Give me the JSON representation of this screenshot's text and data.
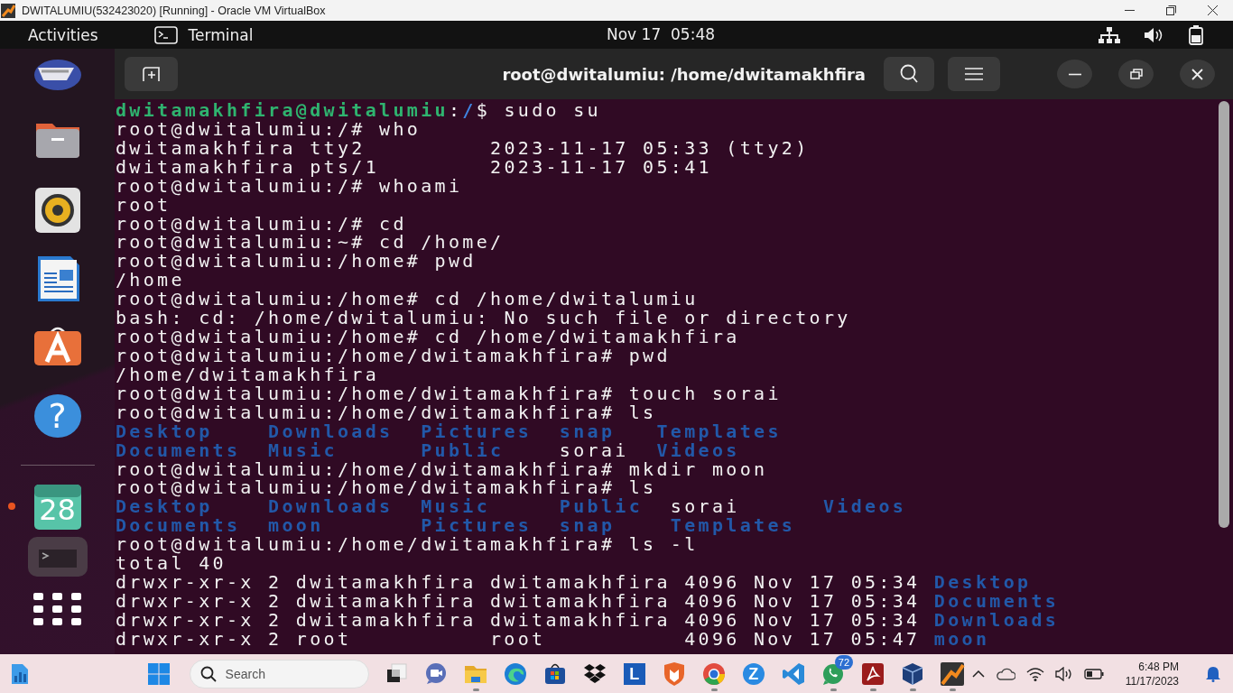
{
  "title_bar": {
    "title": "DWITALUMIU(532423020) [Running] - Oracle VM VirtualBox"
  },
  "top_bar": {
    "activities": "Activities",
    "app_name": "Terminal",
    "clock": "Nov 17  05:48"
  },
  "dock": {
    "pinned": [
      {
        "kind": "partial",
        "running": false
      },
      {
        "kind": "files",
        "running": false
      },
      {
        "kind": "speaker",
        "running": false
      },
      {
        "kind": "writer",
        "running": false
      },
      {
        "kind": "store",
        "running": false
      },
      {
        "kind": "help",
        "running": false,
        "glyph": "?"
      }
    ],
    "others": [
      {
        "kind": "calendar",
        "running": true,
        "glyph": "28"
      },
      {
        "kind": "terminal",
        "running": false
      }
    ]
  },
  "terminal": {
    "title": "root@dwitalumiu: /home/dwitamakhfira",
    "lines": [
      {
        "kind": "prompt",
        "segments": [
          {
            "text": "dwitamakhfira@dwitalumiu",
            "kind": "user"
          },
          {
            "text": ":",
            "kind": "plain"
          },
          {
            "text": "/",
            "kind": "path"
          },
          {
            "text": "$ sudo su",
            "kind": "plain"
          }
        ]
      },
      {
        "kind": "text",
        "text": "root@dwitalumiu:/# who"
      },
      {
        "kind": "text",
        "text": "dwitamakhfira tty2         2023-11-17 05:33 (tty2)"
      },
      {
        "kind": "text",
        "text": "dwitamakhfira pts/1        2023-11-17 05:41"
      },
      {
        "kind": "text",
        "text": "root@dwitalumiu:/# whoami"
      },
      {
        "kind": "text",
        "text": "root"
      },
      {
        "kind": "text",
        "text": "root@dwitalumiu:/# cd"
      },
      {
        "kind": "text",
        "text": "root@dwitalumiu:~# cd /home/"
      },
      {
        "kind": "text",
        "text": "root@dwitalumiu:/home# pwd"
      },
      {
        "kind": "text",
        "text": "/home"
      },
      {
        "kind": "text",
        "text": "root@dwitalumiu:/home# cd /home/dwitalumiu"
      },
      {
        "kind": "text",
        "text": "bash: cd: /home/dwitalumiu: No such file or directory"
      },
      {
        "kind": "text",
        "text": "root@dwitalumiu:/home# cd /home/dwitamakhfira"
      },
      {
        "kind": "text",
        "text": "root@dwitalumiu:/home/dwitamakhfira# pwd"
      },
      {
        "kind": "text",
        "text": "/home/dwitamakhfira"
      },
      {
        "kind": "text",
        "text": "root@dwitalumiu:/home/dwitamakhfira# touch sorai"
      },
      {
        "kind": "text",
        "text": "root@dwitalumiu:/home/dwitamakhfira# ls"
      },
      {
        "kind": "short_listing",
        "rows": [
          [
            {
              "text": "Desktop",
              "dir": true
            },
            {
              "text": "Downloads",
              "dir": true
            },
            {
              "text": "Pictures",
              "dir": true
            },
            {
              "text": "snap",
              "dir": true
            },
            {
              "text": "Templates",
              "dir": true
            }
          ],
          [
            {
              "text": "Documents",
              "dir": true
            },
            {
              "text": "Music",
              "dir": true
            },
            {
              "text": "Public",
              "dir": true
            },
            {
              "text": "sorai",
              "dir": false
            },
            {
              "text": "Videos",
              "dir": true
            }
          ]
        ]
      },
      {
        "kind": "text",
        "text": "root@dwitalumiu:/home/dwitamakhfira# mkdir moon"
      },
      {
        "kind": "text",
        "text": "root@dwitalumiu:/home/dwitamakhfira# ls"
      },
      {
        "kind": "short_listing",
        "rows": [
          [
            {
              "text": "Desktop",
              "dir": true
            },
            {
              "text": "Downloads",
              "dir": true
            },
            {
              "text": "Music",
              "dir": true
            },
            {
              "text": "Public",
              "dir": true
            },
            {
              "text": "sorai",
              "dir": false
            },
            {
              "text": "Videos",
              "dir": true
            }
          ],
          [
            {
              "text": "Documents",
              "dir": true
            },
            {
              "text": "moon",
              "dir": true
            },
            {
              "text": "Pictures",
              "dir": true
            },
            {
              "text": "snap",
              "dir": true
            },
            {
              "text": "Templates",
              "dir": true
            }
          ]
        ]
      },
      {
        "kind": "text",
        "text": "root@dwitalumiu:/home/dwitamakhfira# ls -l"
      },
      {
        "kind": "text",
        "text": "total 40"
      },
      {
        "kind": "long_listing",
        "rows": [
          [
            {
              "text": "drwxr-xr-x",
              "dir": false
            },
            {
              "text": "2",
              "dir": false
            },
            {
              "text": "dwitamakhfira",
              "dir": false
            },
            {
              "text": "dwitamakhfira",
              "dir": false
            },
            {
              "text": "4096",
              "dir": false
            },
            {
              "text": "Nov",
              "dir": false
            },
            {
              "text": "17",
              "dir": false
            },
            {
              "text": "05:34",
              "dir": false
            },
            {
              "text": "Desktop",
              "dir": true
            }
          ],
          [
            {
              "text": "drwxr-xr-x",
              "dir": false
            },
            {
              "text": "2",
              "dir": false
            },
            {
              "text": "dwitamakhfira",
              "dir": false
            },
            {
              "text": "dwitamakhfira",
              "dir": false
            },
            {
              "text": "4096",
              "dir": false
            },
            {
              "text": "Nov",
              "dir": false
            },
            {
              "text": "17",
              "dir": false
            },
            {
              "text": "05:34",
              "dir": false
            },
            {
              "text": "Documents",
              "dir": true
            }
          ],
          [
            {
              "text": "drwxr-xr-x",
              "dir": false
            },
            {
              "text": "2",
              "dir": false
            },
            {
              "text": "dwitamakhfira",
              "dir": false
            },
            {
              "text": "dwitamakhfira",
              "dir": false
            },
            {
              "text": "4096",
              "dir": false
            },
            {
              "text": "Nov",
              "dir": false
            },
            {
              "text": "17",
              "dir": false
            },
            {
              "text": "05:34",
              "dir": false
            },
            {
              "text": "Downloads",
              "dir": true
            }
          ],
          [
            {
              "text": "drwxr-xr-x",
              "dir": false
            },
            {
              "text": "2",
              "dir": false
            },
            {
              "text": "root",
              "dir": false
            },
            {
              "text": "root",
              "dir": false
            },
            {
              "text": "4096",
              "dir": false
            },
            {
              "text": "Nov",
              "dir": false
            },
            {
              "text": "17",
              "dir": false
            },
            {
              "text": "05:47",
              "dir": false
            },
            {
              "text": "moon",
              "dir": true
            }
          ]
        ]
      }
    ]
  },
  "taskbar": {
    "search": {
      "placeholder": "Search"
    },
    "apps": [
      {
        "kind": "taskview",
        "running": false
      },
      {
        "kind": "meet",
        "running": false
      },
      {
        "kind": "explorer",
        "running": true
      },
      {
        "kind": "edge",
        "running": false
      },
      {
        "kind": "store",
        "running": false
      },
      {
        "kind": "dropbox",
        "running": false
      },
      {
        "kind": "letter",
        "running": false,
        "glyph": "L"
      },
      {
        "kind": "shield",
        "running": false
      },
      {
        "kind": "chrome",
        "running": true
      },
      {
        "kind": "letter-round",
        "running": false,
        "glyph": "Z"
      },
      {
        "kind": "code",
        "running": false
      },
      {
        "kind": "whatsapp",
        "running": true,
        "badge": "72"
      },
      {
        "kind": "acrobat",
        "running": true
      },
      {
        "kind": "vbox",
        "running": true
      },
      {
        "kind": "vboxvm",
        "running": true
      }
    ],
    "clock": {
      "time": "6:48 PM",
      "date": "11/17/2023"
    }
  }
}
